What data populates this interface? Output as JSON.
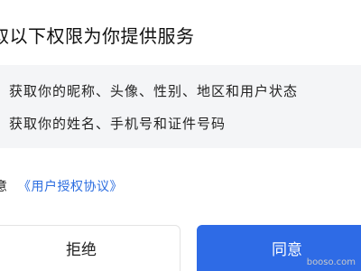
{
  "dialog": {
    "title": "取以下权限为你提供服务",
    "permissions": [
      "获取你的昵称、头像、性别、地区和用户状态",
      "获取你的姓名、手机号和证件号码"
    ],
    "agreement": {
      "prefix": "意",
      "link_label": "《用户授权协议》"
    },
    "buttons": {
      "reject": "拒绝",
      "agree": "同意"
    },
    "colors": {
      "accent": "#2e6be6",
      "link": "#2b6de0",
      "panel": "#f4f5f7"
    }
  },
  "watermark": "booso.com"
}
